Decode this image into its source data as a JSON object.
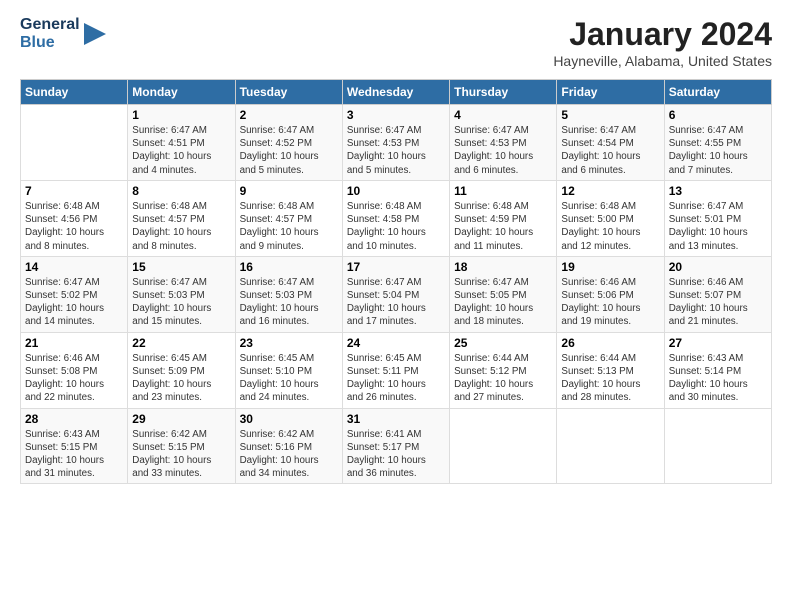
{
  "logo": {
    "line1": "General",
    "line2": "Blue"
  },
  "title": "January 2024",
  "location": "Hayneville, Alabama, United States",
  "days_of_week": [
    "Sunday",
    "Monday",
    "Tuesday",
    "Wednesday",
    "Thursday",
    "Friday",
    "Saturday"
  ],
  "weeks": [
    [
      {
        "day": "",
        "info": ""
      },
      {
        "day": "1",
        "info": "Sunrise: 6:47 AM\nSunset: 4:51 PM\nDaylight: 10 hours\nand 4 minutes."
      },
      {
        "day": "2",
        "info": "Sunrise: 6:47 AM\nSunset: 4:52 PM\nDaylight: 10 hours\nand 5 minutes."
      },
      {
        "day": "3",
        "info": "Sunrise: 6:47 AM\nSunset: 4:53 PM\nDaylight: 10 hours\nand 5 minutes."
      },
      {
        "day": "4",
        "info": "Sunrise: 6:47 AM\nSunset: 4:53 PM\nDaylight: 10 hours\nand 6 minutes."
      },
      {
        "day": "5",
        "info": "Sunrise: 6:47 AM\nSunset: 4:54 PM\nDaylight: 10 hours\nand 6 minutes."
      },
      {
        "day": "6",
        "info": "Sunrise: 6:47 AM\nSunset: 4:55 PM\nDaylight: 10 hours\nand 7 minutes."
      }
    ],
    [
      {
        "day": "7",
        "info": "Sunrise: 6:48 AM\nSunset: 4:56 PM\nDaylight: 10 hours\nand 8 minutes."
      },
      {
        "day": "8",
        "info": "Sunrise: 6:48 AM\nSunset: 4:57 PM\nDaylight: 10 hours\nand 8 minutes."
      },
      {
        "day": "9",
        "info": "Sunrise: 6:48 AM\nSunset: 4:57 PM\nDaylight: 10 hours\nand 9 minutes."
      },
      {
        "day": "10",
        "info": "Sunrise: 6:48 AM\nSunset: 4:58 PM\nDaylight: 10 hours\nand 10 minutes."
      },
      {
        "day": "11",
        "info": "Sunrise: 6:48 AM\nSunset: 4:59 PM\nDaylight: 10 hours\nand 11 minutes."
      },
      {
        "day": "12",
        "info": "Sunrise: 6:48 AM\nSunset: 5:00 PM\nDaylight: 10 hours\nand 12 minutes."
      },
      {
        "day": "13",
        "info": "Sunrise: 6:47 AM\nSunset: 5:01 PM\nDaylight: 10 hours\nand 13 minutes."
      }
    ],
    [
      {
        "day": "14",
        "info": "Sunrise: 6:47 AM\nSunset: 5:02 PM\nDaylight: 10 hours\nand 14 minutes."
      },
      {
        "day": "15",
        "info": "Sunrise: 6:47 AM\nSunset: 5:03 PM\nDaylight: 10 hours\nand 15 minutes."
      },
      {
        "day": "16",
        "info": "Sunrise: 6:47 AM\nSunset: 5:03 PM\nDaylight: 10 hours\nand 16 minutes."
      },
      {
        "day": "17",
        "info": "Sunrise: 6:47 AM\nSunset: 5:04 PM\nDaylight: 10 hours\nand 17 minutes."
      },
      {
        "day": "18",
        "info": "Sunrise: 6:47 AM\nSunset: 5:05 PM\nDaylight: 10 hours\nand 18 minutes."
      },
      {
        "day": "19",
        "info": "Sunrise: 6:46 AM\nSunset: 5:06 PM\nDaylight: 10 hours\nand 19 minutes."
      },
      {
        "day": "20",
        "info": "Sunrise: 6:46 AM\nSunset: 5:07 PM\nDaylight: 10 hours\nand 21 minutes."
      }
    ],
    [
      {
        "day": "21",
        "info": "Sunrise: 6:46 AM\nSunset: 5:08 PM\nDaylight: 10 hours\nand 22 minutes."
      },
      {
        "day": "22",
        "info": "Sunrise: 6:45 AM\nSunset: 5:09 PM\nDaylight: 10 hours\nand 23 minutes."
      },
      {
        "day": "23",
        "info": "Sunrise: 6:45 AM\nSunset: 5:10 PM\nDaylight: 10 hours\nand 24 minutes."
      },
      {
        "day": "24",
        "info": "Sunrise: 6:45 AM\nSunset: 5:11 PM\nDaylight: 10 hours\nand 26 minutes."
      },
      {
        "day": "25",
        "info": "Sunrise: 6:44 AM\nSunset: 5:12 PM\nDaylight: 10 hours\nand 27 minutes."
      },
      {
        "day": "26",
        "info": "Sunrise: 6:44 AM\nSunset: 5:13 PM\nDaylight: 10 hours\nand 28 minutes."
      },
      {
        "day": "27",
        "info": "Sunrise: 6:43 AM\nSunset: 5:14 PM\nDaylight: 10 hours\nand 30 minutes."
      }
    ],
    [
      {
        "day": "28",
        "info": "Sunrise: 6:43 AM\nSunset: 5:15 PM\nDaylight: 10 hours\nand 31 minutes."
      },
      {
        "day": "29",
        "info": "Sunrise: 6:42 AM\nSunset: 5:15 PM\nDaylight: 10 hours\nand 33 minutes."
      },
      {
        "day": "30",
        "info": "Sunrise: 6:42 AM\nSunset: 5:16 PM\nDaylight: 10 hours\nand 34 minutes."
      },
      {
        "day": "31",
        "info": "Sunrise: 6:41 AM\nSunset: 5:17 PM\nDaylight: 10 hours\nand 36 minutes."
      },
      {
        "day": "",
        "info": ""
      },
      {
        "day": "",
        "info": ""
      },
      {
        "day": "",
        "info": ""
      }
    ]
  ]
}
